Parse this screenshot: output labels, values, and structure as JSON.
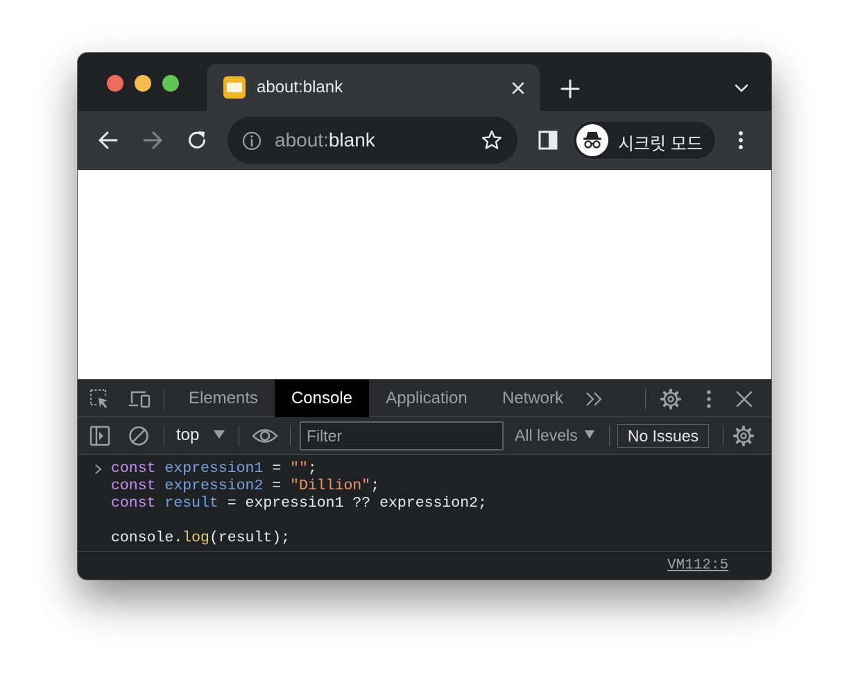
{
  "colors": {
    "window_bg": "#202124",
    "toolbar_bg": "#35363a",
    "tab_bg": "#35363a",
    "traffic_red": "#ee6a5f",
    "traffic_yellow": "#f5bd4f",
    "traffic_green": "#61c454",
    "favicon": "#f0b429",
    "keyword": "#c38ff6",
    "variable": "#72a4e2",
    "string": "#f29766",
    "function": "#e9cd75"
  },
  "browser": {
    "tab": {
      "title": "about:blank",
      "favicon": "document-favicon-icon",
      "close_icon": "close-icon"
    },
    "new_tab_icon": "plus-icon",
    "tab_search_icon": "chevron-down-icon",
    "toolbar": {
      "back_icon": "arrow-left-icon",
      "forward_icon": "arrow-right-icon",
      "reload_icon": "reload-icon",
      "omnibox": {
        "info_icon": "info-icon",
        "url_scheme": "about:",
        "url_rest": "blank",
        "bookmark_icon": "star-icon"
      },
      "side_panel_icon": "side-panel-icon",
      "profile": {
        "icon": "incognito-icon",
        "label": "시크릿 모드"
      },
      "menu_icon": "kebab-menu-icon"
    }
  },
  "devtools": {
    "tabs": [
      {
        "label": "Elements",
        "active": false
      },
      {
        "label": "Console",
        "active": true
      },
      {
        "label": "Application",
        "active": false
      },
      {
        "label": "Network",
        "active": false
      }
    ],
    "more_tabs_icon": "double-chevron-right-icon",
    "console_toolbar": {
      "context": "top",
      "filter_placeholder": "Filter",
      "levels": "All levels",
      "issues": "No Issues"
    },
    "console": {
      "lines": [
        [
          {
            "t": "const",
            "c": "kw"
          },
          {
            "t": " "
          },
          {
            "t": "expression1",
            "c": "var"
          },
          {
            "t": " = "
          },
          {
            "t": "\"\"",
            "c": "str"
          },
          {
            "t": ";"
          }
        ],
        [
          {
            "t": "const",
            "c": "kw"
          },
          {
            "t": " "
          },
          {
            "t": "expression2",
            "c": "var"
          },
          {
            "t": " = "
          },
          {
            "t": "\"Dillion\"",
            "c": "str"
          },
          {
            "t": ";"
          }
        ],
        [
          {
            "t": "const",
            "c": "kw"
          },
          {
            "t": " "
          },
          {
            "t": "result",
            "c": "var"
          },
          {
            "t": " = expression1 ?? expression2;"
          }
        ],
        [],
        [
          {
            "t": "console."
          },
          {
            "t": "log",
            "c": "fn"
          },
          {
            "t": "(result);"
          }
        ]
      ],
      "source_link": "VM112:5"
    }
  }
}
